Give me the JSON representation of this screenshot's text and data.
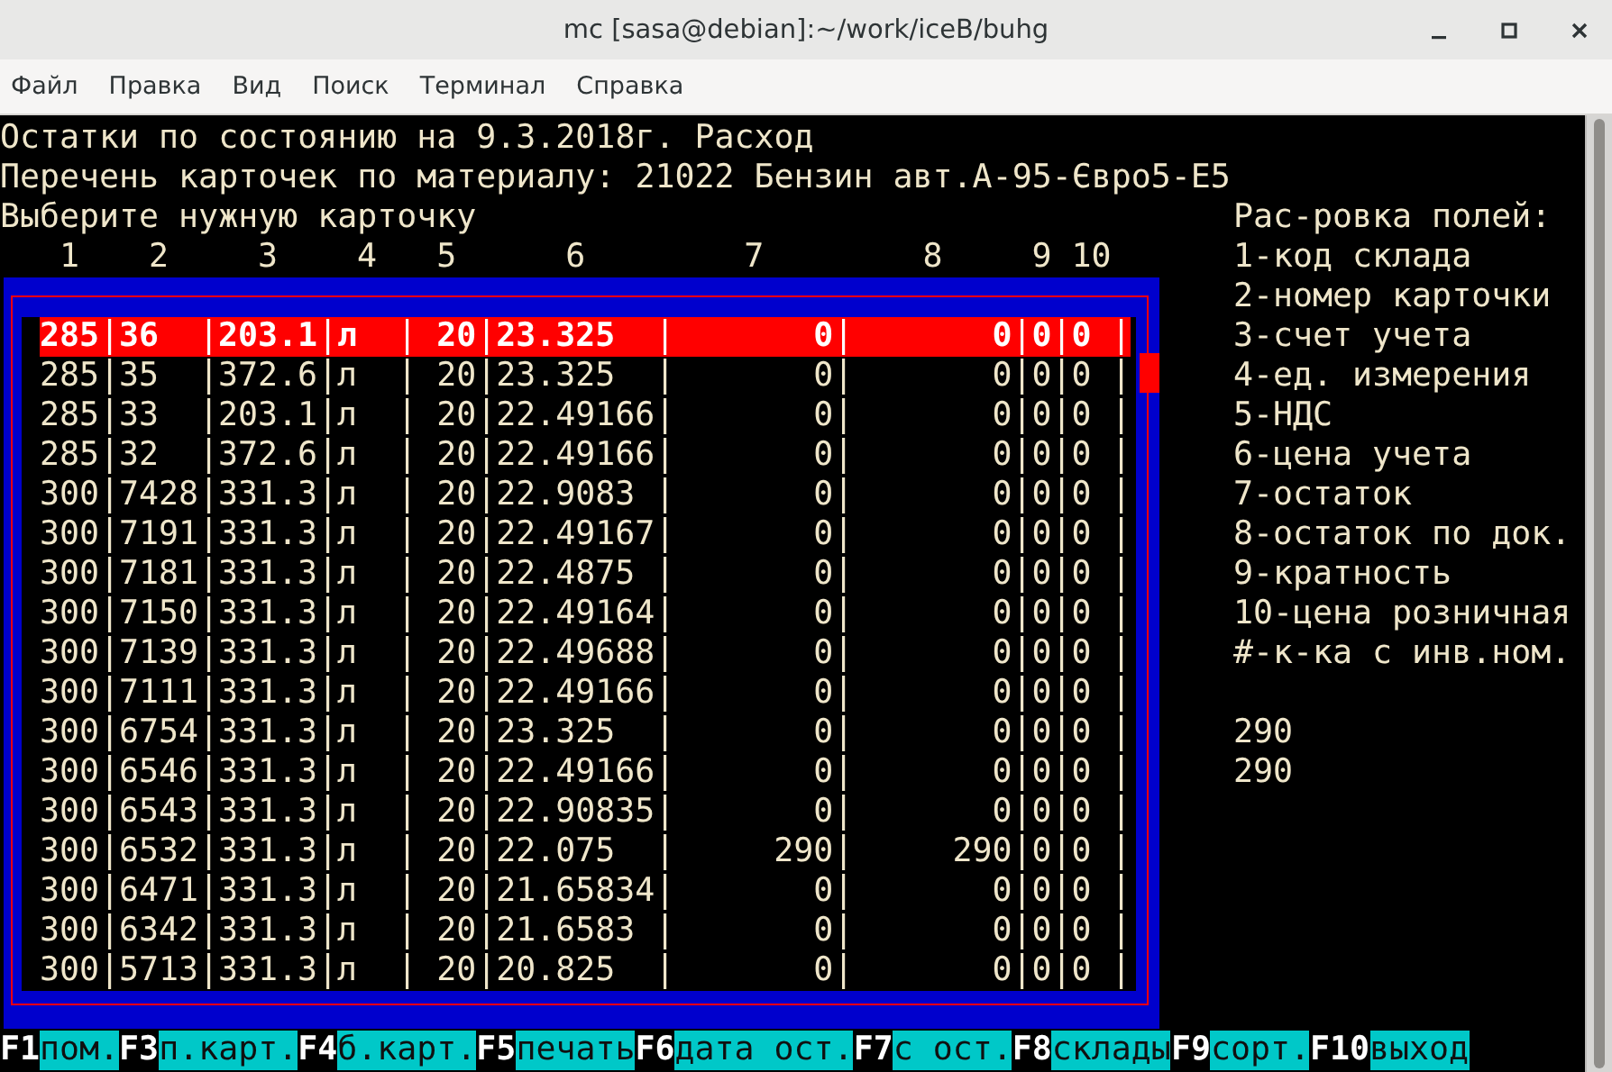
{
  "window": {
    "title": "mc [sasa@debian]:~/work/iceB/buhg"
  },
  "menu": [
    "Файл",
    "Правка",
    "Вид",
    "Поиск",
    "Терминал",
    "Справка"
  ],
  "header_lines": [
    "Остатки по состоянию на 9.3.2018г. Расход",
    "Перечень карточек по материалу: 21022 Бензин авт.А-95-Євро5-Е5"
  ],
  "prompt": "Выберите нужную карточку",
  "column_numbers": [
    "1",
    "2",
    "3",
    "4",
    "5",
    "6",
    "7",
    "8",
    "9",
    "10"
  ],
  "rows": [
    {
      "cells": [
        "285",
        "36",
        "203.1",
        "л",
        "20",
        "23.325",
        "0",
        "0",
        "0",
        "0"
      ],
      "selected": true
    },
    {
      "cells": [
        "285",
        "35",
        "372.6",
        "л",
        "20",
        "23.325",
        "0",
        "0",
        "0",
        "0"
      ],
      "selected": false
    },
    {
      "cells": [
        "285",
        "33",
        "203.1",
        "л",
        "20",
        "22.49166",
        "0",
        "0",
        "0",
        "0"
      ],
      "selected": false
    },
    {
      "cells": [
        "285",
        "32",
        "372.6",
        "л",
        "20",
        "22.49166",
        "0",
        "0",
        "0",
        "0"
      ],
      "selected": false
    },
    {
      "cells": [
        "300",
        "7428",
        "331.3",
        "л",
        "20",
        "22.9083",
        "0",
        "0",
        "0",
        "0"
      ],
      "selected": false
    },
    {
      "cells": [
        "300",
        "7191",
        "331.3",
        "л",
        "20",
        "22.49167",
        "0",
        "0",
        "0",
        "0"
      ],
      "selected": false
    },
    {
      "cells": [
        "300",
        "7181",
        "331.3",
        "л",
        "20",
        "22.4875",
        "0",
        "0",
        "0",
        "0"
      ],
      "selected": false
    },
    {
      "cells": [
        "300",
        "7150",
        "331.3",
        "л",
        "20",
        "22.49164",
        "0",
        "0",
        "0",
        "0"
      ],
      "selected": false
    },
    {
      "cells": [
        "300",
        "7139",
        "331.3",
        "л",
        "20",
        "22.49688",
        "0",
        "0",
        "0",
        "0"
      ],
      "selected": false
    },
    {
      "cells": [
        "300",
        "7111",
        "331.3",
        "л",
        "20",
        "22.49166",
        "0",
        "0",
        "0",
        "0"
      ],
      "selected": false
    },
    {
      "cells": [
        "300",
        "6754",
        "331.3",
        "л",
        "20",
        "23.325",
        "0",
        "0",
        "0",
        "0"
      ],
      "selected": false
    },
    {
      "cells": [
        "300",
        "6546",
        "331.3",
        "л",
        "20",
        "22.49166",
        "0",
        "0",
        "0",
        "0"
      ],
      "selected": false
    },
    {
      "cells": [
        "300",
        "6543",
        "331.3",
        "л",
        "20",
        "22.90835",
        "0",
        "0",
        "0",
        "0"
      ],
      "selected": false
    },
    {
      "cells": [
        "300",
        "6532",
        "331.3",
        "л",
        "20",
        "22.075",
        "290",
        "290",
        "0",
        "0"
      ],
      "selected": false
    },
    {
      "cells": [
        "300",
        "6471",
        "331.3",
        "л",
        "20",
        "21.65834",
        "0",
        "0",
        "0",
        "0"
      ],
      "selected": false
    },
    {
      "cells": [
        "300",
        "6342",
        "331.3",
        "л",
        "20",
        "21.6583",
        "0",
        "0",
        "0",
        "0"
      ],
      "selected": false
    },
    {
      "cells": [
        "300",
        "5713",
        "331.3",
        "л",
        "20",
        "20.825",
        "0",
        "0",
        "0",
        "0"
      ],
      "selected": false
    }
  ],
  "legend": {
    "title": "Рас-ровка полей:",
    "items": [
      "1-код склада",
      "2-номер карточки",
      "3-счет учета",
      "4-ед. измерения",
      "5-НДС",
      "6-цена учета",
      "7-остаток",
      "8-остаток по док.",
      "9-кратность",
      "10-цена розничная",
      "#-к-ка с инв.ном."
    ]
  },
  "totals": [
    "290",
    "290"
  ],
  "function_keys": [
    {
      "key": "F1",
      "label": "пом."
    },
    {
      "key": "F3",
      "label": "п.карт."
    },
    {
      "key": "F4",
      "label": "б.карт."
    },
    {
      "key": "F5",
      "label": "печать"
    },
    {
      "key": "F6",
      "label": "дата ост."
    },
    {
      "key": "F7",
      "label": "с ост."
    },
    {
      "key": "F8",
      "label": "склады"
    },
    {
      "key": "F9",
      "label": "сорт."
    },
    {
      "key": "F10",
      "label": "выход"
    }
  ]
}
